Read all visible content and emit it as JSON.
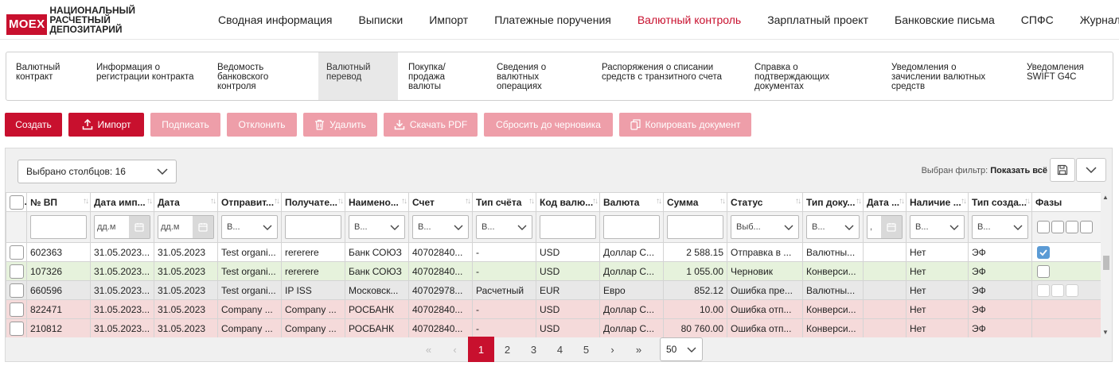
{
  "logo": {
    "badge": "MOEX",
    "lines": [
      "НАЦИОНАЛЬНЫЙ",
      "РАСЧЕТНЫЙ",
      "ДЕПОЗИТАРИЙ"
    ]
  },
  "nav": [
    {
      "label": "Сводная информация",
      "active": false
    },
    {
      "label": "Выписки",
      "active": false
    },
    {
      "label": "Импорт",
      "active": false
    },
    {
      "label": "Платежные поручения",
      "active": false
    },
    {
      "label": "Валютный контроль",
      "active": true
    },
    {
      "label": "Зарплатный проект",
      "active": false
    },
    {
      "label": "Банковские письма",
      "active": false
    },
    {
      "label": "СПФС",
      "active": false
    },
    {
      "label": "Журнал",
      "active": false
    }
  ],
  "subnav": [
    {
      "label": "Валютный\nконтракт",
      "active": false
    },
    {
      "label": "Информация о\nрегистрации контракта",
      "active": false
    },
    {
      "label": "Ведомость\nбанковского\nконтроля",
      "active": false
    },
    {
      "label": "Валютный\nперевод",
      "active": true
    },
    {
      "label": "Покупка/\nпродажа\nвалюты",
      "active": false
    },
    {
      "label": "Сведения о\nвалютных\nоперациях",
      "active": false
    },
    {
      "label": "Распоряжения о списании\nсредств с транзитного счета",
      "active": false
    },
    {
      "label": "Справка о\nподтверждающих\nдокументах",
      "active": false
    },
    {
      "label": "Уведомления о\nзачислении валютных\nсредств",
      "active": false
    },
    {
      "label": "Уведомления\nSWIFT G4C",
      "active": false
    }
  ],
  "toolbar": {
    "create": "Создать",
    "import": "Импорт",
    "sign": "Подписать",
    "reject": "Отклонить",
    "delete": "Удалить",
    "download_pdf": "Скачать PDF",
    "reset_draft": "Сбросить до черновика",
    "copy_doc": "Копировать документ"
  },
  "table_panel": {
    "columns_selected": "Выбрано столбцов: 16",
    "filter_label": "Выбран фильтр:",
    "filter_value": "Показать всё"
  },
  "columns": [
    "№ ВП",
    "Дата имп...",
    "Дата",
    "Отправит...",
    "Получате...",
    "Наимено...",
    "Счет",
    "Тип счёта",
    "Код валю...",
    "Валюта",
    "Сумма",
    "Статус",
    "Тип доку...",
    "Дата ...",
    "Наличие ...",
    "Тип созда...",
    "Фазы"
  ],
  "filters": {
    "date_placeholder": "дд.м",
    "date_short": ",",
    "select_v": "В...",
    "select_vyb": "Выб..."
  },
  "rows": [
    {
      "style": "white",
      "cells": [
        "602363",
        "31.05.2023...",
        "31.05.2023",
        "Test organi...",
        "rererere",
        "Банк СОЮЗ",
        "40702840...",
        "-",
        "USD",
        "Доллар С...",
        "2 588.15",
        "Отправка в ...",
        "Валютны...",
        "",
        "Нет",
        "ЭФ"
      ],
      "phase": "checked"
    },
    {
      "style": "green",
      "cells": [
        "107326",
        "31.05.2023...",
        "31.05.2023",
        "Test organi...",
        "rererere",
        "Банк СОЮЗ",
        "40702840...",
        "-",
        "USD",
        "Доллар С...",
        "1 055.00",
        "Черновик",
        "Конверси...",
        "",
        "Нет",
        "ЭФ"
      ],
      "phase": "single"
    },
    {
      "style": "grey",
      "cells": [
        "660596",
        "31.05.2023...",
        "31.05.2023",
        "Test organi...",
        "IP ISS",
        "Московск...",
        "40702978...",
        "Расчетный",
        "EUR",
        "Евро",
        "852.12",
        "Ошибка пре...",
        "Валютны...",
        "",
        "Нет",
        "ЭФ"
      ],
      "phase": "triple"
    },
    {
      "style": "red",
      "cells": [
        "822471",
        "31.05.2023...",
        "31.05.2023",
        "Company ...",
        "Company ...",
        "РОСБАНК",
        "40702840...",
        "-",
        "USD",
        "Доллар С...",
        "10.00",
        "Ошибка отп...",
        "Конверси...",
        "",
        "Нет",
        "ЭФ"
      ],
      "phase": "none"
    },
    {
      "style": "red",
      "cells": [
        "210812",
        "31.05.2023...",
        "31.05.2023",
        "Company ...",
        "Company ...",
        "РОСБАНК",
        "40702840...",
        "-",
        "USD",
        "Доллар С...",
        "80 760.00",
        "Ошибка отп...",
        "Конверси...",
        "",
        "Нет",
        "ЭФ"
      ],
      "phase": "none"
    }
  ],
  "pagination": {
    "pages": [
      "1",
      "2",
      "3",
      "4",
      "5"
    ],
    "current": "1",
    "page_size": "50"
  },
  "colors": {
    "accent": "#c8102e",
    "accent_disabled": "#ee9ea9",
    "row_green": "#e6f2dc",
    "row_red": "#f5dada",
    "row_grey": "#e8e8e8"
  }
}
